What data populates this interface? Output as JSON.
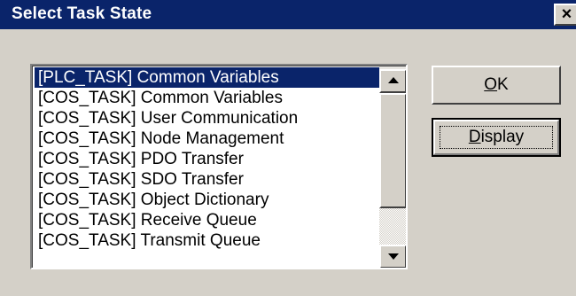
{
  "dialog": {
    "title": "Select Task State",
    "close_label": "×"
  },
  "list": {
    "selected_index": 0,
    "items": [
      "[PLC_TASK] Common Variables",
      "[COS_TASK] Common Variables",
      "[COS_TASK] User Communication",
      "[COS_TASK] Node Management",
      "[COS_TASK] PDO Transfer",
      "[COS_TASK] SDO Transfer",
      "[COS_TASK] Object Dictionary",
      "[COS_TASK] Receive Queue",
      "[COS_TASK] Transmit Queue"
    ]
  },
  "buttons": {
    "ok": {
      "mnemonic": "O",
      "rest": "K"
    },
    "display": {
      "mnemonic": "D",
      "rest": "isplay"
    }
  },
  "colors": {
    "titlebar": "#0a246a",
    "selection": "#0a246a",
    "face": "#d4d0c8"
  },
  "icons": {
    "close": "close-icon",
    "scroll_up": "scroll-up-arrow-icon",
    "scroll_down": "scroll-down-arrow-icon"
  }
}
